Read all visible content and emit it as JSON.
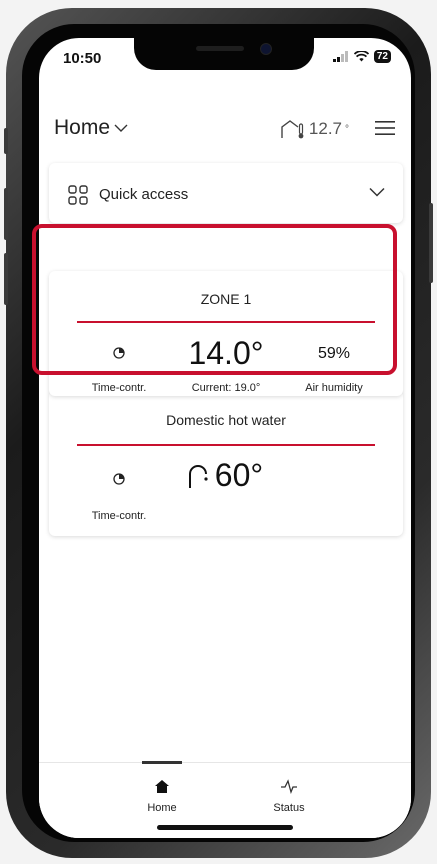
{
  "status_bar": {
    "time": "10:50",
    "battery": "72"
  },
  "app_bar": {
    "title": "Home",
    "outdoor_temp": "12.7",
    "outdoor_temp_unit": "°"
  },
  "quick_access": {
    "label": "Quick access"
  },
  "zone1": {
    "title": "ZONE 1",
    "mode_label": "Time-contr.",
    "temperature": "14.0°",
    "current_label": "Current: 19.0°",
    "humidity": "59%",
    "humidity_label": "Air humidity"
  },
  "dhw": {
    "title": "Domestic hot water",
    "mode_label": "Time-contr.",
    "temperature": "60°"
  },
  "nav": {
    "home": "Home",
    "status": "Status"
  },
  "colors": {
    "accent": "#c8102e"
  }
}
